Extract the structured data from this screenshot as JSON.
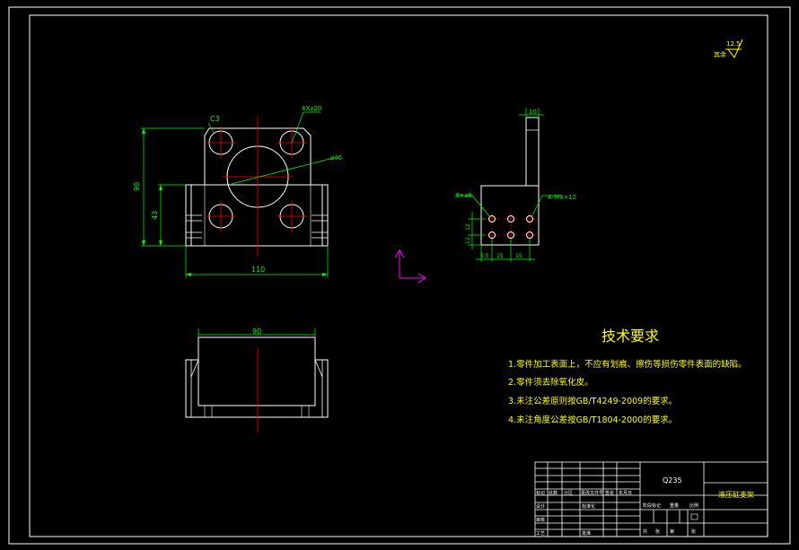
{
  "surface_roughness": {
    "value": "12.5",
    "label": "其余"
  },
  "dimensions": {
    "chamfer": "C3",
    "holes": "4X⌀20",
    "bore": "⌀46",
    "height_total": "90",
    "height_lower": "43",
    "width_base": "110",
    "side_top": "10",
    "side_hole_left": "8×⌀8",
    "side_hole_right": "4-M6×12",
    "side_v1": "12",
    "side_v2": "12",
    "side_h1": "5.5",
    "side_h2": "15",
    "side_h3": "15",
    "bottom_width": "90"
  },
  "tech_req": {
    "title": "技术要求",
    "items": [
      "1.零件加工表面上，不应有划痕、擦伤等损伤零件表面的缺陷。",
      "2.零件须去除氧化皮。",
      "3.未注公差原则按GB/T4249-2009的要求。",
      "4.未注角度公差按GB/T1804-2000的要求。"
    ]
  },
  "title_block": {
    "material": "Q235",
    "part_name": "液压缸支架",
    "row_labels": [
      "标记",
      "处数",
      "分区",
      "更改文件号",
      "签名",
      "年月日"
    ],
    "design": "设计",
    "standardize": "标准化",
    "review": "审核",
    "process": "工艺",
    "approve": "批准",
    "stage_mark": "阶段标记",
    "weight": "重量",
    "scale": "比例",
    "sheet_total": "共",
    "sheet_of": "张",
    "sheet_no": "第"
  },
  "colors": {
    "background": "#000000",
    "frame": "#ffffff",
    "dimension": "#00ff00",
    "center": "#ff0000",
    "text": "#ffff00",
    "ucs": "#ff00ff"
  }
}
